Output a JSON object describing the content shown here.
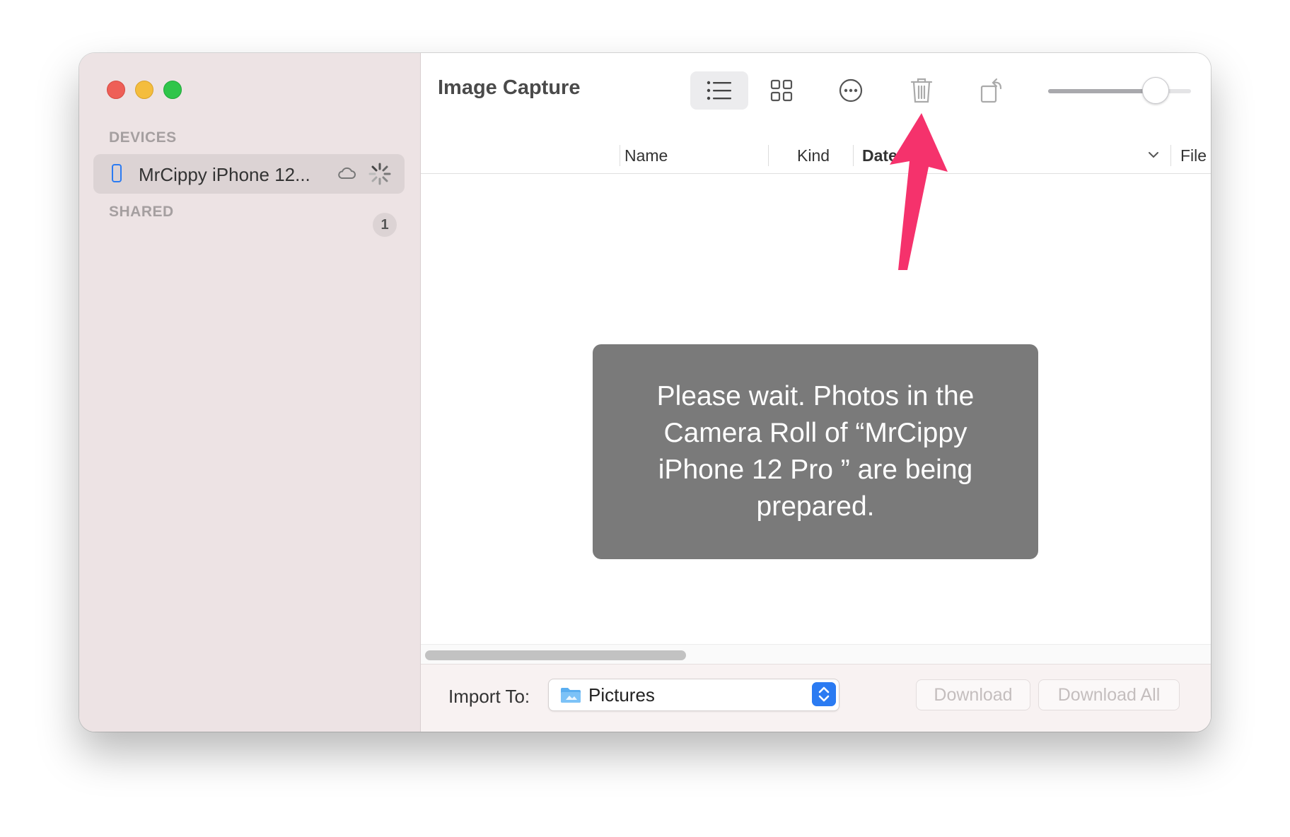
{
  "window": {
    "controls": [
      "close",
      "minimize",
      "maximize"
    ]
  },
  "sidebar": {
    "devices_label": "DEVICES",
    "device": {
      "name": "MrCippy iPhone 12...",
      "icon": "iphone-icon",
      "status_icons": [
        "cloud-icon",
        "spinner-icon"
      ],
      "accent": "#2b7bf2"
    },
    "shared_label": "SHARED",
    "shared_count": "1"
  },
  "toolbar": {
    "title": "Image Capture",
    "buttons": [
      "list-view-icon",
      "grid-view-icon",
      "more-options-icon",
      "trash-icon",
      "rotate-icon"
    ],
    "zoom_slider_fraction": 0.75
  },
  "table": {
    "columns": [
      {
        "label": "Name",
        "sorted": false
      },
      {
        "label": "Kind",
        "sorted": false
      },
      {
        "label": "Date",
        "sorted": true
      },
      {
        "label": "File S",
        "sorted": false
      }
    ]
  },
  "overlay": {
    "message": "Please wait. Photos in the Camera Roll of “MrCippy iPhone 12 Pro ” are being prepared."
  },
  "scrollbar": {
    "thumb_fraction": 0.33
  },
  "bottom_bar": {
    "import_label": "Import To:",
    "import_value": "Pictures",
    "download_label": "Download",
    "download_all_label": "Download All"
  },
  "annotation": {
    "arrow_color": "#f5326c"
  }
}
